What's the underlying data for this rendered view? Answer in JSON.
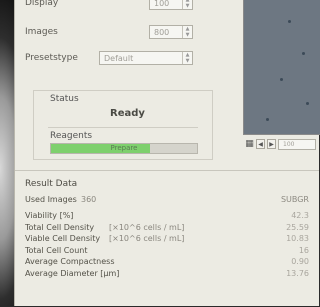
{
  "left_fields": [
    {
      "label": "Display",
      "value": "100"
    },
    {
      "label": "Images",
      "value": "800"
    },
    {
      "label": "Presetstype",
      "value": "Default"
    }
  ],
  "status": {
    "group_title": "Status",
    "value": "Ready",
    "reagents_label": "Reagents",
    "progress_text": "Prepare",
    "progress_percent": 68
  },
  "viewer": {
    "tool_icons": [
      "grid-icon",
      "arrow-left-icon",
      "arrow-right-icon"
    ],
    "page_label": "100"
  },
  "results": {
    "title": "Result Data",
    "header": {
      "label": "Used Images",
      "count": "360",
      "col_title": "SUBGR"
    },
    "rows": [
      {
        "label": "Viability [%]",
        "unit": "",
        "value": "42.3"
      },
      {
        "label": "Total Cell Density",
        "unit": "[×10^6 cells / mL]",
        "value": "25.59"
      },
      {
        "label": "Viable Cell Density",
        "unit": "[×10^6 cells / mL]",
        "value": "10.83"
      },
      {
        "label": "Total Cell Count",
        "unit": "",
        "value": "16"
      },
      {
        "label": "Average Compactness",
        "unit": "",
        "value": "0.90"
      },
      {
        "label": "Average Diameter [µm]",
        "unit": "",
        "value": "13.76"
      }
    ]
  },
  "colors": {
    "progress": "#7ed06d",
    "viewer_bg": "#6d7782",
    "dialog_bg": "#ecebe3"
  }
}
